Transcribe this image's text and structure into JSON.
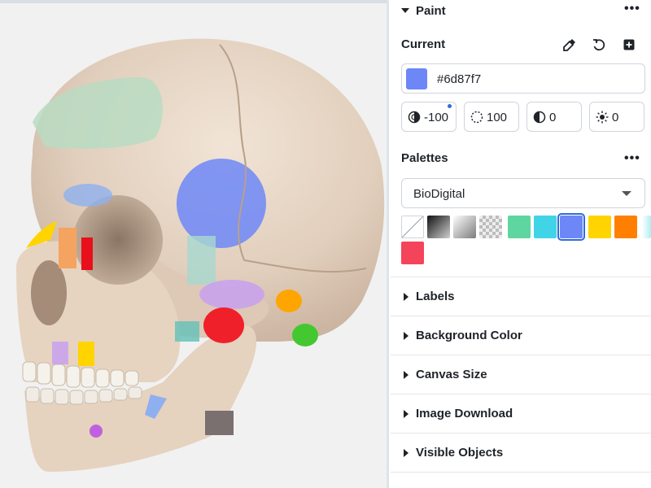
{
  "panel": {
    "paint": {
      "title": "Paint",
      "more_icon": "more-horizontal-icon"
    },
    "current": {
      "title": "Current",
      "tools": [
        {
          "name": "eyedropper-icon"
        },
        {
          "name": "reset-icon"
        },
        {
          "name": "add-square-icon"
        }
      ],
      "color_hex": "#6d87f7",
      "adjustments": [
        {
          "name": "contrast",
          "icon": "contrast-icon",
          "value": "-100",
          "modified": true
        },
        {
          "name": "opacity",
          "icon": "opacity-icon",
          "value": "100",
          "modified": false
        },
        {
          "name": "shade",
          "icon": "shade-icon",
          "value": "0",
          "modified": false
        },
        {
          "name": "brightness",
          "icon": "brightness-icon",
          "value": "0",
          "modified": false
        }
      ]
    },
    "palettes": {
      "title": "Palettes",
      "selected": "BioDigital",
      "swatches": [
        {
          "name": "none",
          "color": "#ffffff"
        },
        {
          "name": "dark-gradient",
          "color": "#444444"
        },
        {
          "name": "light-gradient",
          "color": "#bbbbbb"
        },
        {
          "name": "checker",
          "color": "#cccccc"
        },
        {
          "name": "green",
          "color": "#5fd6a0"
        },
        {
          "name": "cyan",
          "color": "#40d4e6"
        },
        {
          "name": "blue",
          "color": "#6d87f7"
        },
        {
          "name": "yellow",
          "color": "#ffd400"
        },
        {
          "name": "orange",
          "color": "#ff8000"
        },
        {
          "name": "red",
          "color": "#f4445a"
        }
      ],
      "selected_swatch": "blue"
    },
    "sections": [
      {
        "id": "labels",
        "label": "Labels"
      },
      {
        "id": "background-color",
        "label": "Background Color"
      },
      {
        "id": "canvas-size",
        "label": "Canvas Size"
      },
      {
        "id": "image-download",
        "label": "Image Download"
      },
      {
        "id": "visible-objects",
        "label": "Visible Objects"
      }
    ]
  },
  "colors": {
    "viewport_bg": "#f1f1f1",
    "bone": "#e8d8c8",
    "accent": "#2f6bdc"
  }
}
